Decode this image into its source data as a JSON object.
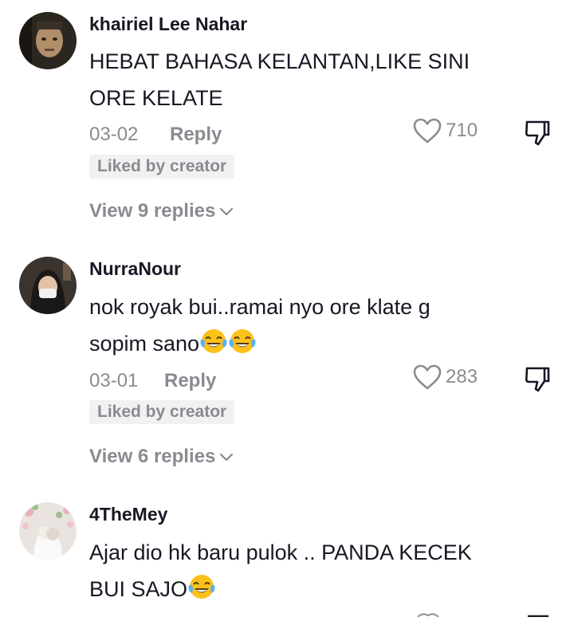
{
  "comments": [
    {
      "username": "khairiel Lee Nahar",
      "text_lines": [
        "HEBAT BAHASA KELANTAN,LIKE SINI",
        "ORE KELATE"
      ],
      "date": "03-02",
      "reply_label": "Reply",
      "likes": "710",
      "badge": "Liked by creator",
      "view_replies": "View 9 replies"
    },
    {
      "username": "NurraNour",
      "text_lines": [
        "nok royak bui..ramai nyo ore klate g",
        "sopim sano"
      ],
      "text_emojis": [
        "😂",
        "😂"
      ],
      "date": "03-01",
      "reply_label": "Reply",
      "likes": "283",
      "badge": "Liked by creator",
      "view_replies": "View 6 replies"
    },
    {
      "username": "4TheMey",
      "text_lines": [
        "Ajar dio hk baru pulok .. PANDA KECEK",
        "BUI SAJO"
      ],
      "text_emojis": [
        "😂"
      ]
    }
  ],
  "icons": {
    "like": "heart-outline-icon",
    "dislike": "thumbs-down-icon",
    "expand": "chevron-down-icon",
    "emoji": "face-with-tears-of-joy"
  },
  "colors": {
    "primary_text": "#161823",
    "secondary_text": "#8a8b91",
    "badge_bg": "#f1f1f2"
  }
}
